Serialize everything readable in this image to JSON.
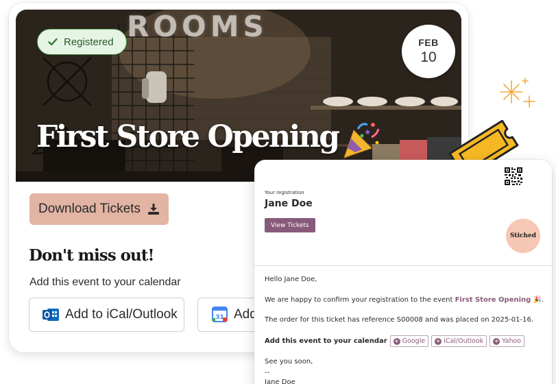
{
  "event": {
    "status_badge": "Registered",
    "sign_text": "ROOMS",
    "date_month": "FEB",
    "date_day": "10",
    "title": "First Store Opening",
    "download_label": "Download Tickets",
    "dont_miss": "Don't miss out!",
    "add_event_sub": "Add this event to your calendar",
    "calendar_buttons": [
      {
        "label": "Add to iCal/Outlook",
        "icon": "outlook-calendar-icon"
      },
      {
        "label": "Add",
        "icon": "google-calendar-icon",
        "icon_text": "31"
      }
    ]
  },
  "email": {
    "your_registration": "Your registration",
    "name": "Jane Doe",
    "view_tickets": "View Tickets",
    "logo_text": "Stiched",
    "greeting": "Hello Jane Doe,",
    "confirm_prefix": "We are happy to confirm your registration to the event ",
    "confirm_event": "First Store Opening",
    "order_line": "The order for this ticket has reference S00008 and was placed on 2025-01-16.",
    "add_calendar_label": "Add this event to your calendar",
    "calendar_links": [
      "Google",
      "iCal/Outlook",
      "Yahoo"
    ],
    "see_you": "See you soon,",
    "dashes": "--",
    "signature": "Jane Doe"
  },
  "colors": {
    "registered_bg": "#e6f4e6",
    "registered_border": "#4c9a4c",
    "download_bg": "#e2b4a4",
    "email_accent": "#875a7b",
    "logo_bg": "#f6c7b4",
    "ticket_fill": "#f5b823"
  }
}
